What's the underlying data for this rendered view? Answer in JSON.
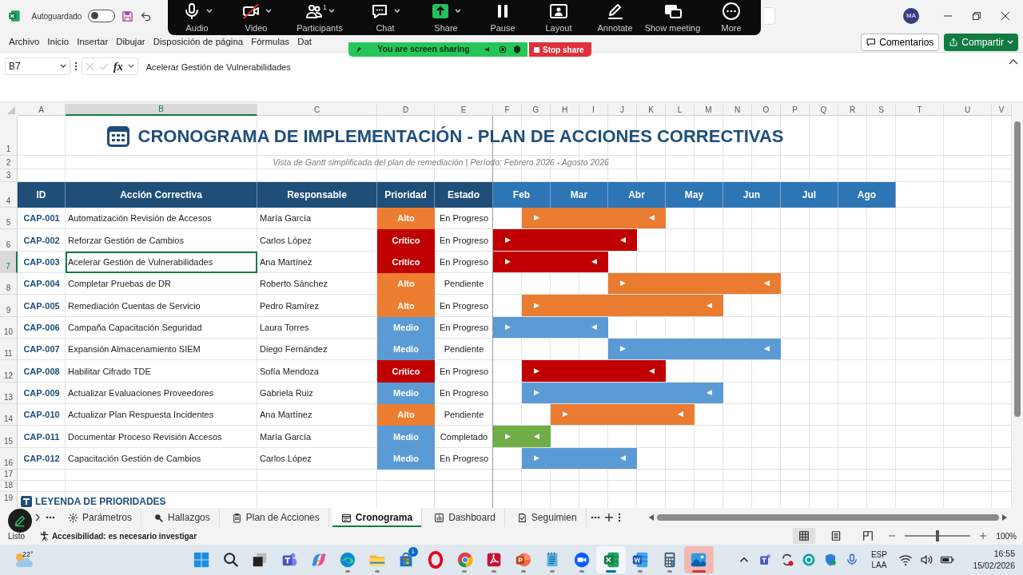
{
  "titlebar": {
    "autosave_label": "Autoguardado",
    "autosave_on": false,
    "avatar": "MA"
  },
  "menu": [
    "Archivo",
    "Inicio",
    "Insertar",
    "Dibujar",
    "Disposición de página",
    "Fórmulas",
    "Dat"
  ],
  "ribbon_actions": {
    "comments": "Comentarios",
    "share": "Compartir"
  },
  "meeting_toolbar": [
    {
      "label": "Audio",
      "kind": "mic",
      "caret": true
    },
    {
      "label": "Video",
      "kind": "video-off",
      "caret": true
    },
    {
      "label": "Participants",
      "kind": "people",
      "caret": true,
      "badge": "1"
    },
    {
      "label": "Chat",
      "kind": "chat",
      "caret": true
    },
    {
      "label": "Share",
      "kind": "share",
      "caret": true
    },
    {
      "label": "Pause",
      "kind": "pause",
      "caret": false
    },
    {
      "label": "Layout",
      "kind": "layout",
      "caret": false
    },
    {
      "label": "Annotate",
      "kind": "annotate",
      "caret": false
    },
    {
      "label": "Show meeting",
      "kind": "show-meeting",
      "caret": false
    },
    {
      "label": "More",
      "kind": "more",
      "caret": false
    }
  ],
  "sharing_banner": {
    "text": "You are screen sharing",
    "stop_button": "Stop share"
  },
  "formula_bar": {
    "cell": "B7",
    "fx": "fx",
    "formula": "Acelerar Gestión de Vulnerabilidades"
  },
  "sheet": {
    "columns": [
      {
        "label": "A",
        "selected": false
      },
      {
        "label": "B",
        "selected": true
      },
      {
        "label": "C",
        "selected": false
      },
      {
        "label": "D",
        "selected": false
      },
      {
        "label": "E",
        "selected": false
      },
      {
        "label": "F",
        "selected": false
      },
      {
        "label": "G",
        "selected": false
      },
      {
        "label": "H",
        "selected": false
      },
      {
        "label": "I",
        "selected": false
      },
      {
        "label": "J",
        "selected": false
      },
      {
        "label": "K",
        "selected": false
      },
      {
        "label": "L",
        "selected": false
      },
      {
        "label": "M",
        "selected": false
      },
      {
        "label": "N",
        "selected": false
      },
      {
        "label": "O",
        "selected": false
      },
      {
        "label": "P",
        "selected": false
      },
      {
        "label": "Q",
        "selected": false
      },
      {
        "label": "R",
        "selected": false
      },
      {
        "label": "S",
        "selected": false
      },
      {
        "label": "T",
        "selected": false
      },
      {
        "label": "U",
        "selected": false
      },
      {
        "label": "V",
        "selected": false
      }
    ],
    "row_numbers": [
      {
        "label": "1",
        "selected": false
      },
      {
        "label": "2",
        "selected": false
      },
      {
        "label": "3",
        "selected": false
      },
      {
        "label": "4",
        "selected": false
      },
      {
        "label": "5",
        "selected": false
      },
      {
        "label": "6",
        "selected": false
      },
      {
        "label": "7",
        "selected": true
      },
      {
        "label": "8",
        "selected": false
      },
      {
        "label": "9",
        "selected": false
      },
      {
        "label": "10",
        "selected": false
      },
      {
        "label": "11",
        "selected": false
      },
      {
        "label": "12",
        "selected": false
      },
      {
        "label": "13",
        "selected": false
      },
      {
        "label": "14",
        "selected": false
      },
      {
        "label": "15",
        "selected": false
      },
      {
        "label": "16",
        "selected": false
      },
      {
        "label": "17",
        "selected": false
      },
      {
        "label": "18",
        "selected": false
      },
      {
        "label": "19",
        "selected": false
      }
    ],
    "title": "CRONOGRAMA DE IMPLEMENTACIÓN - PLAN DE ACCIONES CORRECTIVAS",
    "subtitle": "Vista de Gantt simplificada del plan de remediación | Período: Febrero 2026 - Agosto 2026",
    "headers": [
      "ID",
      "Acción Correctiva",
      "Responsable",
      "Prioridad",
      "Estado"
    ],
    "months": [
      "Feb",
      "Mar",
      "Abr",
      "May",
      "Jun",
      "Jul",
      "Ago"
    ],
    "rows": [
      {
        "id": "CAP-001",
        "action": "Automatización Revisión de Accesos",
        "owner": "María García",
        "priority": {
          "text": "Alto",
          "color": "#ed7d31"
        },
        "status": "En Progreso",
        "selected": false,
        "timeline": [
          {
            "filled": false
          },
          {
            "filled": true,
            "color": "#e97c30",
            "text": "▶"
          },
          {
            "filled": true,
            "color": "#e97c30"
          },
          {
            "filled": true,
            "color": "#e97c30"
          },
          {
            "filled": true,
            "color": "#e97c30"
          },
          {
            "filled": true,
            "color": "#e97c30",
            "text": "◀"
          },
          {
            "filled": false
          },
          {
            "filled": false
          },
          {
            "filled": false
          },
          {
            "filled": false
          },
          {
            "filled": false
          },
          {
            "filled": false
          },
          {
            "filled": false
          },
          {
            "filled": false
          }
        ]
      },
      {
        "id": "CAP-002",
        "action": "Reforzar Gestión de Cambios",
        "owner": "Carlos López",
        "priority": {
          "text": "Crítico",
          "color": "#c00000"
        },
        "status": "En Progreso",
        "selected": false,
        "timeline": [
          {
            "filled": true,
            "color": "#c00000",
            "text": "▶"
          },
          {
            "filled": true,
            "color": "#c00000"
          },
          {
            "filled": true,
            "color": "#c00000"
          },
          {
            "filled": true,
            "color": "#c00000"
          },
          {
            "filled": true,
            "color": "#c00000",
            "text": "◀"
          },
          {
            "filled": false
          },
          {
            "filled": false
          },
          {
            "filled": false
          },
          {
            "filled": false
          },
          {
            "filled": false
          },
          {
            "filled": false
          },
          {
            "filled": false
          },
          {
            "filled": false
          },
          {
            "filled": false
          }
        ]
      },
      {
        "id": "CAP-003",
        "action": "Acelerar Gestión de Vulnerabilidades",
        "owner": "Ana Martínez",
        "priority": {
          "text": "Crítico",
          "color": "#c00000"
        },
        "status": "En Progreso",
        "selected": true,
        "timeline": [
          {
            "filled": true,
            "color": "#c00000",
            "text": "▶"
          },
          {
            "filled": true,
            "color": "#c00000"
          },
          {
            "filled": true,
            "color": "#c00000"
          },
          {
            "filled": true,
            "color": "#c00000",
            "text": "◀"
          },
          {
            "filled": false
          },
          {
            "filled": false
          },
          {
            "filled": false
          },
          {
            "filled": false
          },
          {
            "filled": false
          },
          {
            "filled": false
          },
          {
            "filled": false
          },
          {
            "filled": false
          },
          {
            "filled": false
          },
          {
            "filled": false
          }
        ]
      },
      {
        "id": "CAP-004",
        "action": "Completar Pruebas de DR",
        "owner": "Roberto Sánchez",
        "priority": {
          "text": "Alto",
          "color": "#ed7d31"
        },
        "status": "Pendiente",
        "selected": false,
        "timeline": [
          {
            "filled": false
          },
          {
            "filled": false
          },
          {
            "filled": false
          },
          {
            "filled": false
          },
          {
            "filled": true,
            "color": "#e97c30",
            "text": "▶"
          },
          {
            "filled": true,
            "color": "#e97c30"
          },
          {
            "filled": true,
            "color": "#e97c30"
          },
          {
            "filled": true,
            "color": "#e97c30"
          },
          {
            "filled": true,
            "color": "#e97c30"
          },
          {
            "filled": true,
            "color": "#e97c30",
            "text": "◀"
          },
          {
            "filled": false
          },
          {
            "filled": false
          },
          {
            "filled": false
          },
          {
            "filled": false
          }
        ]
      },
      {
        "id": "CAP-005",
        "action": "Remediación Cuentas de Servicio",
        "owner": "Pedro Ramírez",
        "priority": {
          "text": "Alto",
          "color": "#ed7d31"
        },
        "status": "En Progreso",
        "selected": false,
        "timeline": [
          {
            "filled": false
          },
          {
            "filled": true,
            "color": "#e97c30",
            "text": "▶"
          },
          {
            "filled": true,
            "color": "#e97c30"
          },
          {
            "filled": true,
            "color": "#e97c30"
          },
          {
            "filled": true,
            "color": "#e97c30"
          },
          {
            "filled": true,
            "color": "#e97c30"
          },
          {
            "filled": true,
            "color": "#e97c30"
          },
          {
            "filled": true,
            "color": "#e97c30",
            "text": "◀"
          },
          {
            "filled": false
          },
          {
            "filled": false
          },
          {
            "filled": false
          },
          {
            "filled": false
          },
          {
            "filled": false
          },
          {
            "filled": false
          }
        ]
      },
      {
        "id": "CAP-006",
        "action": "Campaña Capacitación Seguridad",
        "owner": "Laura Torres",
        "priority": {
          "text": "Medio",
          "color": "#5b9bd5"
        },
        "status": "En Progreso",
        "selected": false,
        "timeline": [
          {
            "filled": true,
            "color": "#5b9bd5",
            "text": "▶"
          },
          {
            "filled": true,
            "color": "#5b9bd5"
          },
          {
            "filled": true,
            "color": "#5b9bd5"
          },
          {
            "filled": true,
            "color": "#5b9bd5",
            "text": "◀"
          },
          {
            "filled": false
          },
          {
            "filled": false
          },
          {
            "filled": false
          },
          {
            "filled": false
          },
          {
            "filled": false
          },
          {
            "filled": false
          },
          {
            "filled": false
          },
          {
            "filled": false
          },
          {
            "filled": false
          },
          {
            "filled": false
          }
        ]
      },
      {
        "id": "CAP-007",
        "action": "Expansión Almacenamiento SIEM",
        "owner": "Diego Fernández",
        "priority": {
          "text": "Medio",
          "color": "#5b9bd5"
        },
        "status": "Pendiente",
        "selected": false,
        "timeline": [
          {
            "filled": false
          },
          {
            "filled": false
          },
          {
            "filled": false
          },
          {
            "filled": false
          },
          {
            "filled": true,
            "color": "#5b9bd5",
            "text": "▶"
          },
          {
            "filled": true,
            "color": "#5b9bd5"
          },
          {
            "filled": true,
            "color": "#5b9bd5"
          },
          {
            "filled": true,
            "color": "#5b9bd5"
          },
          {
            "filled": true,
            "color": "#5b9bd5"
          },
          {
            "filled": true,
            "color": "#5b9bd5",
            "text": "◀"
          },
          {
            "filled": false
          },
          {
            "filled": false
          },
          {
            "filled": false
          },
          {
            "filled": false
          }
        ]
      },
      {
        "id": "CAP-008",
        "action": "Habilitar Cifrado TDE",
        "owner": "Sofía Mendoza",
        "priority": {
          "text": "Crítico",
          "color": "#c00000"
        },
        "status": "En Progreso",
        "selected": false,
        "timeline": [
          {
            "filled": false
          },
          {
            "filled": true,
            "color": "#c00000",
            "text": "▶"
          },
          {
            "filled": true,
            "color": "#c00000"
          },
          {
            "filled": true,
            "color": "#c00000"
          },
          {
            "filled": true,
            "color": "#c00000"
          },
          {
            "filled": true,
            "color": "#c00000",
            "text": "◀"
          },
          {
            "filled": false
          },
          {
            "filled": false
          },
          {
            "filled": false
          },
          {
            "filled": false
          },
          {
            "filled": false
          },
          {
            "filled": false
          },
          {
            "filled": false
          },
          {
            "filled": false
          }
        ]
      },
      {
        "id": "CAP-009",
        "action": "Actualizar Evaluaciones Proveedores",
        "owner": "Gabriela Ruiz",
        "priority": {
          "text": "Medio",
          "color": "#5b9bd5"
        },
        "status": "En Progreso",
        "selected": false,
        "timeline": [
          {
            "filled": false
          },
          {
            "filled": true,
            "color": "#5b9bd5",
            "text": "▶"
          },
          {
            "filled": true,
            "color": "#5b9bd5"
          },
          {
            "filled": true,
            "color": "#5b9bd5"
          },
          {
            "filled": true,
            "color": "#5b9bd5"
          },
          {
            "filled": true,
            "color": "#5b9bd5"
          },
          {
            "filled": true,
            "color": "#5b9bd5"
          },
          {
            "filled": true,
            "color": "#5b9bd5",
            "text": "◀"
          },
          {
            "filled": false
          },
          {
            "filled": false
          },
          {
            "filled": false
          },
          {
            "filled": false
          },
          {
            "filled": false
          },
          {
            "filled": false
          }
        ]
      },
      {
        "id": "CAP-010",
        "action": "Actualizar Plan Respuesta Incidentes",
        "owner": "Ana Martínez",
        "priority": {
          "text": "Alto",
          "color": "#ed7d31"
        },
        "status": "Pendiente",
        "selected": false,
        "timeline": [
          {
            "filled": false
          },
          {
            "filled": false
          },
          {
            "filled": true,
            "color": "#e97c30",
            "text": "▶"
          },
          {
            "filled": true,
            "color": "#e97c30"
          },
          {
            "filled": true,
            "color": "#e97c30"
          },
          {
            "filled": true,
            "color": "#e97c30"
          },
          {
            "filled": true,
            "color": "#e97c30",
            "text": "◀"
          },
          {
            "filled": false
          },
          {
            "filled": false
          },
          {
            "filled": false
          },
          {
            "filled": false
          },
          {
            "filled": false
          },
          {
            "filled": false
          },
          {
            "filled": false
          }
        ]
      },
      {
        "id": "CAP-011",
        "action": "Documentar Proceso Revisión Accesos",
        "owner": "María García",
        "priority": {
          "text": "Medio",
          "color": "#5b9bd5"
        },
        "status": "Completado",
        "selected": false,
        "timeline": [
          {
            "filled": true,
            "color": "#70ad47",
            "text": "▶"
          },
          {
            "filled": true,
            "color": "#70ad47",
            "text": "◀"
          },
          {
            "filled": false
          },
          {
            "filled": false
          },
          {
            "filled": false
          },
          {
            "filled": false
          },
          {
            "filled": false
          },
          {
            "filled": false
          },
          {
            "filled": false
          },
          {
            "filled": false
          },
          {
            "filled": false
          },
          {
            "filled": false
          },
          {
            "filled": false
          },
          {
            "filled": false
          }
        ]
      },
      {
        "id": "CAP-012",
        "action": "Capacitación Gestión de Cambios",
        "owner": "Carlos López",
        "priority": {
          "text": "Medio",
          "color": "#5b9bd5"
        },
        "status": "En Progreso",
        "selected": false,
        "timeline": [
          {
            "filled": false
          },
          {
            "filled": true,
            "color": "#5b9bd5",
            "text": "▶"
          },
          {
            "filled": true,
            "color": "#5b9bd5"
          },
          {
            "filled": true,
            "color": "#5b9bd5"
          },
          {
            "filled": true,
            "color": "#5b9bd5",
            "text": "◀"
          },
          {
            "filled": false
          },
          {
            "filled": false
          },
          {
            "filled": false
          },
          {
            "filled": false
          },
          {
            "filled": false
          },
          {
            "filled": false
          },
          {
            "filled": false
          },
          {
            "filled": false
          },
          {
            "filled": false
          }
        ]
      }
    ],
    "legend_title": "LEYENDA DE PRIORIDADES"
  },
  "sheet_tabs": [
    {
      "label": "Parámetros",
      "kind": "gear",
      "selected": false
    },
    {
      "label": "Hallazgos",
      "kind": "search",
      "selected": false
    },
    {
      "label": "Plan de Acciones",
      "kind": "clipboard",
      "selected": false
    },
    {
      "label": "Cronograma",
      "kind": "calendar",
      "selected": true
    },
    {
      "label": "Dashboard",
      "kind": "chart",
      "selected": false
    },
    {
      "label": "Seguimien",
      "kind": "tracking",
      "selected": false
    }
  ],
  "status_bar": {
    "ready": "Listo",
    "accessibility": "Accesibilidad: es necesario investigar",
    "views": [
      {
        "kind": "normal",
        "selected": true
      },
      {
        "kind": "page-layout",
        "selected": false
      },
      {
        "kind": "page-break",
        "selected": false
      }
    ],
    "zoom_slider": {
      "level": 0.5
    },
    "zoom": "100%"
  },
  "taskbar": {
    "weather": "22°",
    "apps": [
      {
        "kind": "start",
        "running": false,
        "active": false,
        "attention": false
      },
      {
        "kind": "search",
        "running": false,
        "active": false,
        "attention": false
      },
      {
        "kind": "task-view",
        "running": false,
        "active": false,
        "attention": false
      },
      {
        "kind": "teams",
        "running": false,
        "active": false,
        "attention": false
      },
      {
        "kind": "copilot",
        "running": false,
        "active": false,
        "attention": false
      },
      {
        "kind": "edge",
        "running": true,
        "active": false,
        "attention": false
      },
      {
        "kind": "explorer",
        "running": true,
        "active": false,
        "attention": false
      },
      {
        "kind": "store",
        "running": false,
        "active": false,
        "attention": false,
        "badge": "1"
      },
      {
        "kind": "opera",
        "running": false,
        "active": false,
        "attention": false
      },
      {
        "kind": "chrome",
        "running": true,
        "active": false,
        "attention": false
      },
      {
        "kind": "acrobat",
        "running": true,
        "active": false,
        "attention": false
      },
      {
        "kind": "powerpoint",
        "running": true,
        "active": false,
        "attention": false
      },
      {
        "kind": "notepad",
        "running": true,
        "active": false,
        "attention": false
      },
      {
        "kind": "zoom",
        "running": true,
        "active": false,
        "attention": false
      },
      {
        "kind": "excel",
        "running": true,
        "active": true,
        "attention": false
      },
      {
        "kind": "word",
        "running": true,
        "active": false,
        "attention": false
      },
      {
        "kind": "calculator",
        "running": true,
        "active": false,
        "attention": false
      },
      {
        "kind": "photos",
        "running": true,
        "active": false,
        "attention": true
      }
    ],
    "tray": [
      {
        "kind": "chevron"
      },
      {
        "kind": "teams"
      },
      {
        "kind": "sync"
      },
      {
        "kind": "e"
      },
      {
        "kind": "shield"
      },
      {
        "kind": "mic"
      }
    ],
    "language": "ESP",
    "region": "LAA",
    "time": "16:55",
    "date": "15/02/2026"
  }
}
